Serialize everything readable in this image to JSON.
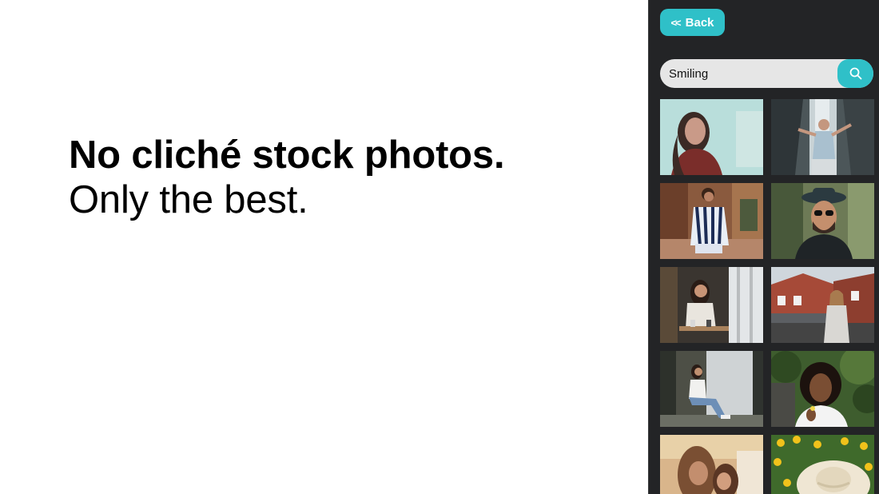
{
  "hero": {
    "title": "No cliché stock photos.",
    "subtitle": "Only the best."
  },
  "panel": {
    "back_label": "Back",
    "back_icon": "double-chevron-left-icon",
    "search": {
      "value": "Smiling",
      "icon": "search-icon"
    },
    "photos": [
      {
        "name": "photo-woman-pale-backdrop"
      },
      {
        "name": "photo-woman-waterfall"
      },
      {
        "name": "photo-woman-striped-shirt-steps"
      },
      {
        "name": "photo-man-hat-sunglasses"
      },
      {
        "name": "photo-woman-cafe-table"
      },
      {
        "name": "photo-woman-street-houses"
      },
      {
        "name": "photo-woman-sitting-window"
      },
      {
        "name": "photo-woman-curly-hair-trees"
      },
      {
        "name": "photo-mother-child"
      },
      {
        "name": "photo-sun-hat-flowers"
      }
    ]
  },
  "colors": {
    "accent": "#2fc0c8",
    "panel_bg": "#232426",
    "search_bg": "#e6e6e6",
    "text": "#000000"
  }
}
